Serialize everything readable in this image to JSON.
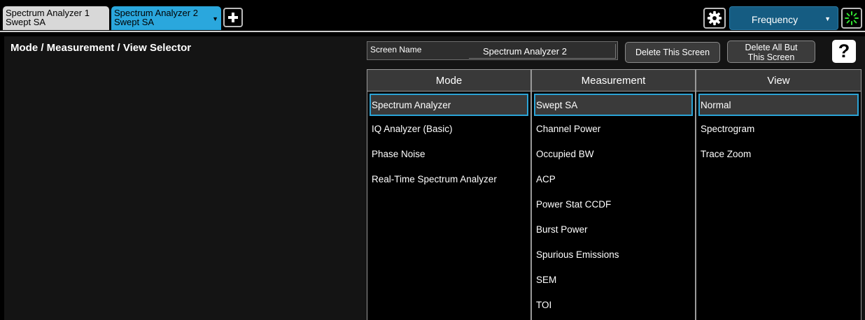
{
  "tabs": [
    {
      "line1": "Spectrum Analyzer 1",
      "line2": "Swept SA"
    },
    {
      "line1": "Spectrum Analyzer 2",
      "line2": "Swept SA"
    }
  ],
  "top_right": {
    "frequency_label": "Frequency"
  },
  "panel": {
    "title": "Mode / Measurement / View Selector",
    "screen_name_label": "Screen Name",
    "screen_name_value": "Spectrum Analyzer 2",
    "delete_screen_label": "Delete This Screen",
    "delete_all_but_line1": "Delete All But",
    "delete_all_but_line2": "This Screen",
    "help_label": "?"
  },
  "selector": {
    "mode": {
      "header": "Mode",
      "items": [
        "Spectrum Analyzer",
        "IQ Analyzer (Basic)",
        "Phase Noise",
        "Real-Time Spectrum Analyzer"
      ],
      "selected": "Spectrum Analyzer"
    },
    "measurement": {
      "header": "Measurement",
      "items": [
        "Swept SA",
        "Channel Power",
        "Occupied BW",
        "ACP",
        "Power Stat CCDF",
        "Burst Power",
        "Spurious Emissions",
        "SEM",
        "TOI"
      ],
      "selected": "Swept SA"
    },
    "view": {
      "header": "View",
      "items": [
        "Normal",
        "Spectrogram",
        "Trace Zoom"
      ],
      "selected": "Normal"
    }
  },
  "colors": {
    "active_tab": "#2aa7dd",
    "selection_border": "#2ba3d6",
    "frequency_button": "#155c82",
    "busy_indicator": "#33e233"
  },
  "icons": [
    "plus-icon",
    "gear-icon",
    "dropdown-arrow-icon",
    "busy-spinner-icon",
    "help-icon"
  ]
}
